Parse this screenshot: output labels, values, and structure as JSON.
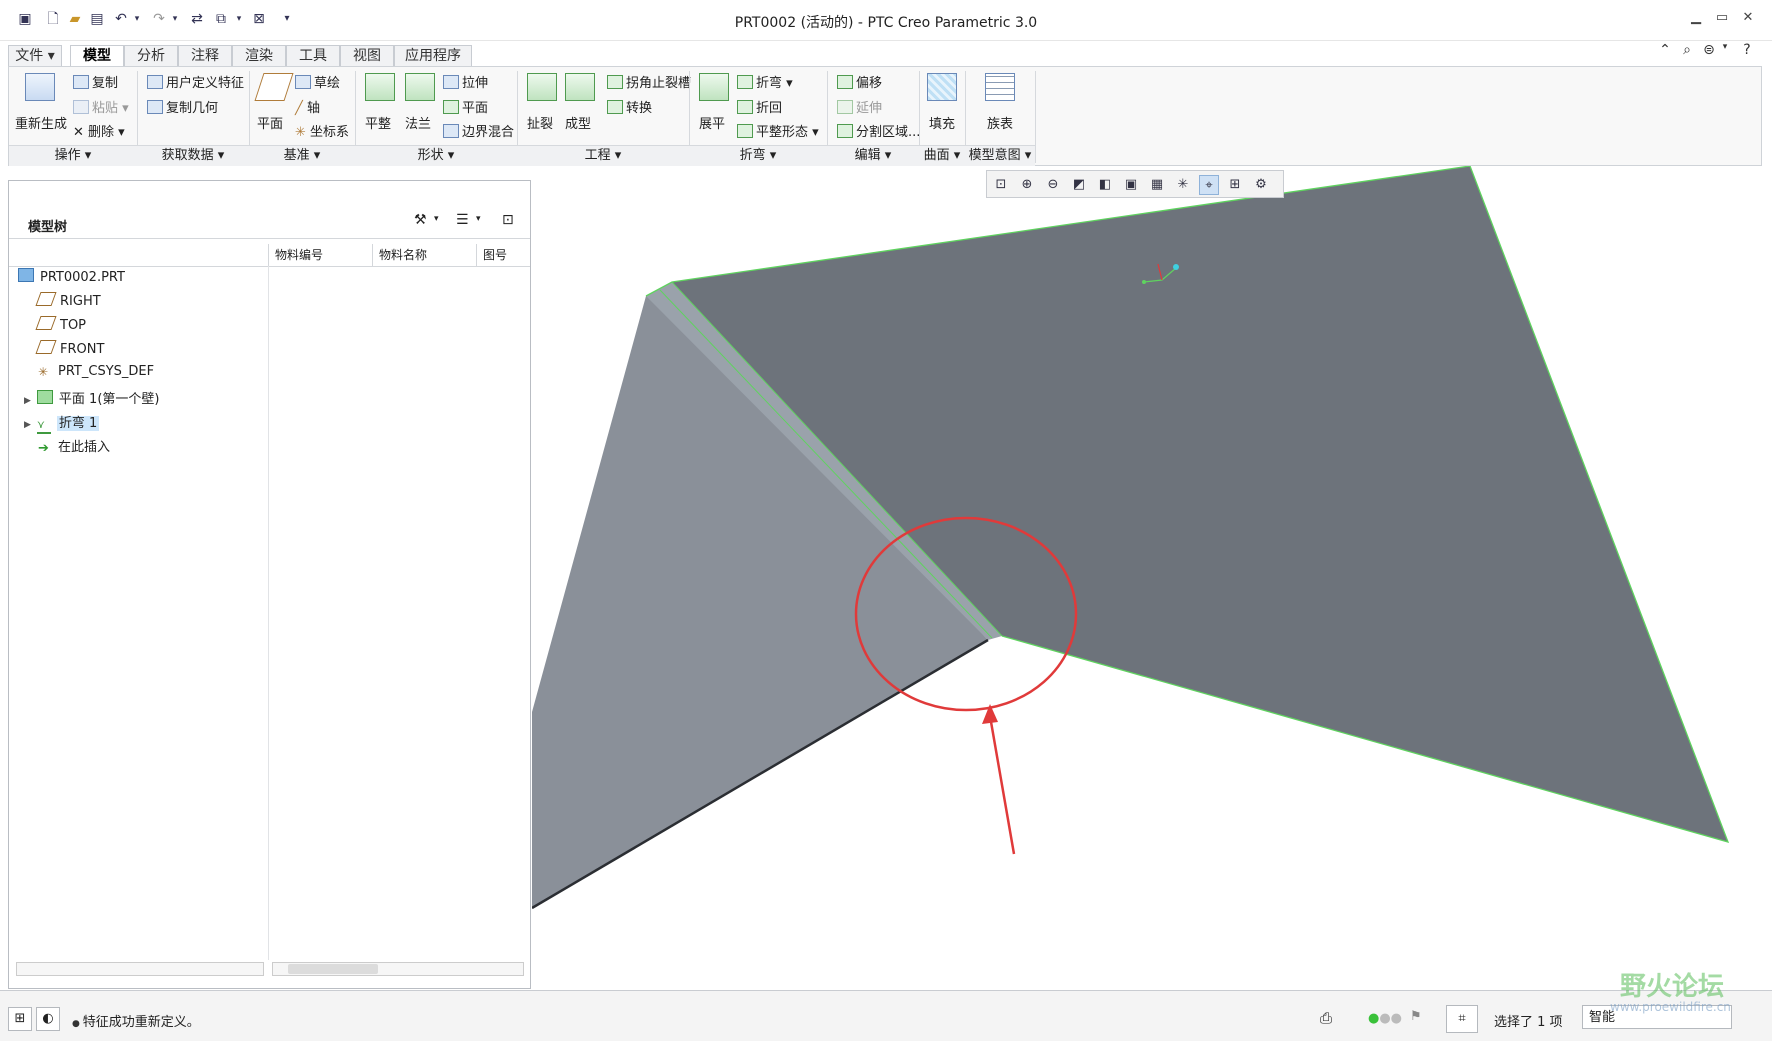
{
  "window": {
    "title": "PRT0002 (活动的) - PTC Creo Parametric 3.0"
  },
  "tabs": [
    "文件",
    "模型",
    "分析",
    "注释",
    "渲染",
    "工具",
    "视图",
    "应用程序"
  ],
  "ribbon": {
    "operations": {
      "regenerate": "重新生成",
      "copy": "复制",
      "paste": "粘贴",
      "delete": "删除",
      "label": "操作"
    },
    "get_data": {
      "udf": "用户定义特征",
      "copy_geometry": "复制几何",
      "label": "获取数据"
    },
    "datum": {
      "plane": "平面",
      "sketch": "草绘",
      "axis": "轴",
      "csys": "坐标系",
      "label": "基准"
    },
    "shapes": {
      "planar": "平整",
      "flange": "法兰",
      "extrude": "拉伸",
      "plane": "平面",
      "boundary_blend": "边界混合",
      "label": "形状"
    },
    "engineering": {
      "rip": "扯裂",
      "form": "成型",
      "corner_relief": "拐角止裂槽",
      "convert": "转换",
      "label": "工程"
    },
    "bends": {
      "unbend": "展平",
      "bend": "折弯",
      "bend_back": "折回",
      "flat_state": "平整形态",
      "label": "折弯"
    },
    "editing": {
      "offset": "偏移",
      "extend": "延伸",
      "split_area": "分割区域...",
      "label": "编辑"
    },
    "surfaces": {
      "fill": "填充",
      "label": "曲面"
    },
    "design_intent": {
      "family_table": "族表",
      "label": "模型意图"
    }
  },
  "model_tree": {
    "title": "模型树",
    "columns": [
      "物料编号",
      "物料名称",
      "图号"
    ],
    "items": [
      {
        "label": "PRT0002.PRT",
        "icon": "part-icon"
      },
      {
        "label": "RIGHT",
        "icon": "datum-plane-icon"
      },
      {
        "label": "TOP",
        "icon": "datum-plane-icon"
      },
      {
        "label": "FRONT",
        "icon": "datum-plane-icon"
      },
      {
        "label": "PRT_CSYS_DEF",
        "icon": "csys-icon"
      },
      {
        "label": "平面 1(第一个壁)",
        "icon": "planar-wall-icon"
      },
      {
        "label": "折弯 1",
        "icon": "bend-icon"
      },
      {
        "label": "在此插入",
        "icon": "insert-here-icon"
      }
    ]
  },
  "status": {
    "message": "特征成功重新定义。",
    "selection": "选择了 1 项",
    "filter": "智能"
  },
  "watermark": {
    "text": "野火论坛",
    "url": "www.proewildfire.cn"
  },
  "colors": {
    "sheet_dark": "#6d737b",
    "sheet_light": "#8c929a",
    "edge_green": "#5fd35f",
    "annotation_red": "#e03a3a",
    "tree_selection": "#cde6fb"
  }
}
